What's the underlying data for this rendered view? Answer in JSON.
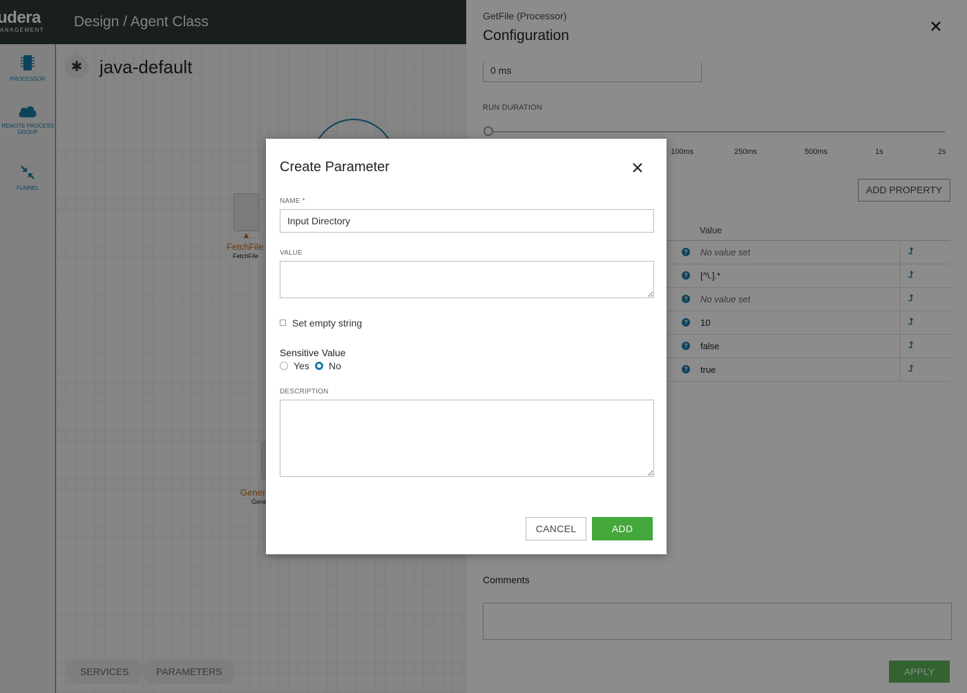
{
  "app": {
    "logo_main": "udera",
    "logo_sub": "ANAGEMENT",
    "breadcrumb": "Design / Agent Class"
  },
  "leftnav": {
    "items": [
      {
        "label": "PROCESSOR",
        "icon": "chip-icon"
      },
      {
        "label": "REMOTE PROCESS GROUP",
        "icon": "cloud-icon"
      },
      {
        "label": "FUNNEL",
        "icon": "funnel-icon"
      }
    ]
  },
  "canvas": {
    "flow_name": "java-default",
    "flow_icon": "✱",
    "processors": [
      {
        "name": "FetchFile",
        "type": "FetchFile"
      },
      {
        "name": "Gener",
        "type": "Gene"
      }
    ],
    "bottom_tabs": [
      "SERVICES",
      "PARAMETERS"
    ]
  },
  "config_panel": {
    "subtitle": "GetFile (Processor)",
    "title": "Configuration",
    "scheduling_value": "0 ms",
    "run_duration_label": "RUN DURATION",
    "run_duration_ticks": [
      "100ms",
      "250ms",
      "500ms",
      "1s",
      "2s"
    ],
    "run_duration_selected": "0ms",
    "add_property_label": "ADD PROPERTY",
    "value_column_header": "Value",
    "properties": [
      {
        "value": "No value set",
        "empty": true
      },
      {
        "value": "[^\\.].*",
        "empty": false
      },
      {
        "value": "No value set",
        "empty": true
      },
      {
        "value": "10",
        "empty": false
      },
      {
        "value": "false",
        "empty": false
      },
      {
        "value": "true",
        "empty": false
      }
    ],
    "comments_label": "Comments",
    "apply_label": "APPLY"
  },
  "modal": {
    "title": "Create Parameter",
    "name_label": "NAME *",
    "name_value": "Input Directory",
    "value_label": "VALUE",
    "value_text": "",
    "empty_string_label": "Set empty string",
    "empty_string_checked": false,
    "sensitive_label": "Sensitive Value",
    "sensitive_options": [
      "Yes",
      "No"
    ],
    "sensitive_selected": "No",
    "description_label": "DESCRIPTION",
    "description_text": "",
    "cancel_label": "CANCEL",
    "add_label": "ADD"
  },
  "colors": {
    "accent": "#1a7ba8",
    "primary_button": "#44a83c",
    "warning": "#c06a1b",
    "topbar": "#2f3a3a"
  }
}
